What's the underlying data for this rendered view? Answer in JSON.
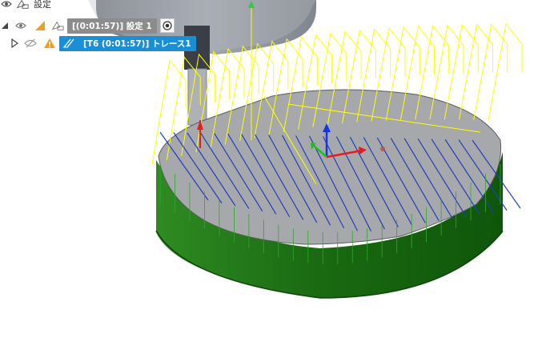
{
  "browser": {
    "root": {
      "label": "設定"
    },
    "setup": {
      "label": "[(0:01:57)] 設定 1"
    },
    "operation": {
      "label": "[T6 (0:01:57)] トレース1"
    }
  },
  "colors": {
    "setup_chip": "#8c8c8c",
    "operation_chip": "#1b8fd6",
    "warning": "#f0a020",
    "stock_top": "#a9aaad",
    "stock_side": "#1f7a14",
    "toolpath": "#ffff00",
    "retract": "#1f3fbf"
  }
}
